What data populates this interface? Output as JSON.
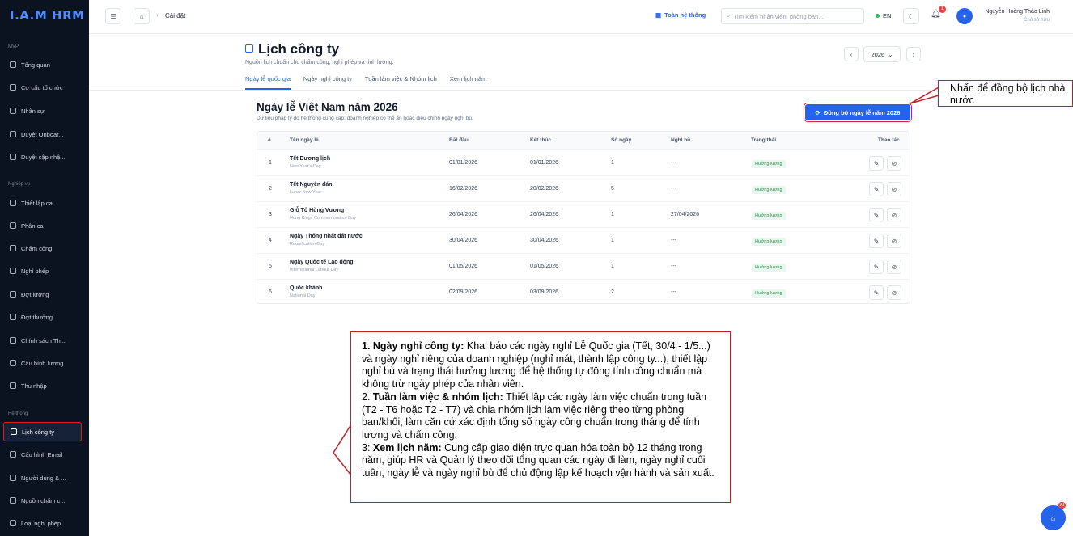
{
  "sidebar": {
    "logo": "I.A.M HRM",
    "sections": [
      "MVP",
      "Nghiệp vụ",
      "Hệ thống"
    ],
    "items": [
      {
        "label": "Tổng quan"
      },
      {
        "label": "Cơ cấu tổ chức"
      },
      {
        "label": "Nhân sự"
      },
      {
        "label": "Duyệt Onboar..."
      },
      {
        "label": "Duyệt cập nhậ..."
      },
      {
        "label": "Thiết lập ca"
      },
      {
        "label": "Phân ca"
      },
      {
        "label": "Chấm công"
      },
      {
        "label": "Nghỉ phép"
      },
      {
        "label": "Đợt lương"
      },
      {
        "label": "Đợt thưởng"
      },
      {
        "label": "Chính sách Th..."
      },
      {
        "label": "Cấu hình lương"
      },
      {
        "label": "Thu nhập"
      },
      {
        "label": "Lịch công ty"
      },
      {
        "label": "Cấu hình Email"
      },
      {
        "label": "Người dùng & ..."
      },
      {
        "label": "Nguồn chấm c..."
      },
      {
        "label": "Loại nghỉ phép"
      }
    ]
  },
  "topbar": {
    "breadcrumb": "Cài đặt",
    "scope": "Toàn hệ thống",
    "search_placeholder": "Tìm kiếm nhân viên, phòng ban...",
    "lang": "EN",
    "notif_count": "1",
    "user_name": "Nguyễn Hoàng Thảo Linh",
    "user_role": "Chủ sở hữu"
  },
  "page": {
    "title": "Lịch công ty",
    "subtitle": "Nguồn lịch chuẩn cho chấm công, nghỉ phép và tính lương.",
    "year": "2026",
    "tabs": [
      "Ngày lễ quốc gia",
      "Ngày nghỉ công ty",
      "Tuần làm việc & Nhóm lịch",
      "Xem lịch năm"
    ]
  },
  "section": {
    "title": "Ngày lễ Việt Nam năm 2026",
    "subtitle": "Dữ liệu pháp lý do hệ thống cung cấp; doanh nghiệp có thể ẩn hoặc điều chỉnh ngày nghỉ bù.",
    "sync_button": "Đồng bộ ngày lễ năm 2026"
  },
  "table": {
    "headers": [
      "#",
      "Tên ngày lễ",
      "Bắt đầu",
      "Kết thúc",
      "Số ngày",
      "Nghỉ bù",
      "Trạng thái",
      "Thao tác"
    ],
    "rows": [
      {
        "no": "1",
        "name": "Tết Dương lịch",
        "en": "New Year's Day",
        "start": "01/01/2026",
        "end": "01/01/2026",
        "days": "1",
        "comp": "---",
        "status": "Hưởng lương"
      },
      {
        "no": "2",
        "name": "Tết Nguyên đán",
        "en": "Lunar New Year",
        "start": "16/02/2026",
        "end": "20/02/2026",
        "days": "5",
        "comp": "---",
        "status": "Hưởng lương"
      },
      {
        "no": "3",
        "name": "Giỗ Tổ Hùng Vương",
        "en": "Hung Kings Commemoration Day",
        "start": "26/04/2026",
        "end": "26/04/2026",
        "days": "1",
        "comp": "27/04/2026",
        "status": "Hưởng lương"
      },
      {
        "no": "4",
        "name": "Ngày Thống nhất đất nước",
        "en": "Reunification Day",
        "start": "30/04/2026",
        "end": "30/04/2026",
        "days": "1",
        "comp": "---",
        "status": "Hưởng lương"
      },
      {
        "no": "5",
        "name": "Ngày Quốc tế Lao động",
        "en": "International Labour Day",
        "start": "01/05/2026",
        "end": "01/05/2026",
        "days": "1",
        "comp": "---",
        "status": "Hưởng lương"
      },
      {
        "no": "6",
        "name": "Quốc khánh",
        "en": "National Day",
        "start": "02/09/2026",
        "end": "03/09/2026",
        "days": "2",
        "comp": "---",
        "status": "Hưởng lương"
      }
    ]
  },
  "callouts": {
    "sync": "Nhấn để đồng bộ lịch nhà nước",
    "p1_bold": "1. Ngày nghỉ công ty:",
    "p1": " Khai báo các ngày nghỉ Lễ Quốc gia (Tết, 30/4 - 1/5...) và ngày nghỉ riêng của doanh nghiệp (nghỉ mát, thành lập công ty...), thiết lập nghỉ bù và trạng thái hưởng lương để hệ thống tự động tính công chuẩn mà không trừ ngày phép của nhân viên.",
    "p2_prefix": "2. ",
    "p2_bold": "Tuần làm việc & nhóm lịch:",
    "p2": " Thiết lập các ngày làm việc chuẩn trong tuần (T2 - T6 hoặc T2 - T7) và chia nhóm lịch làm việc riêng theo từng phòng ban/khối, làm căn cứ xác định tổng số ngày công chuẩn trong tháng để tính lương và chấm công.",
    "p3_prefix": "3: ",
    "p3_bold": "Xem lịch năm:",
    "p3": " Cung cấp giao diện trực quan hóa toàn bộ 12 tháng trong năm, giúp HR và Quản lý theo dõi tổng quan các ngày đi làm, ngày nghỉ cuối tuần, ngày lễ và ngày nghỉ bù để chủ động lập kế hoạch vận hành và sản xuất."
  },
  "ai_badge": "AI"
}
